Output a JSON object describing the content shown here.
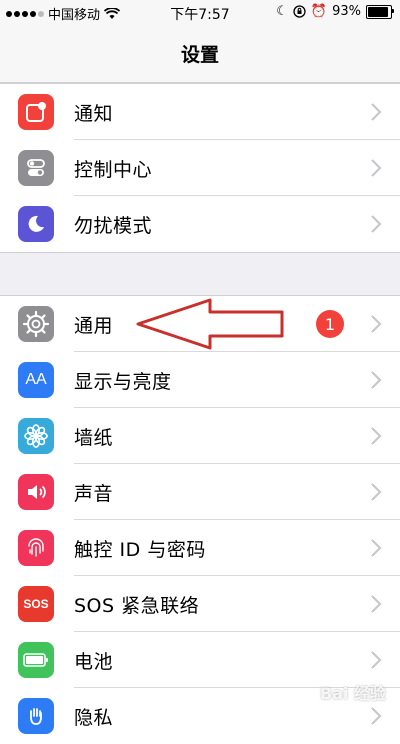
{
  "status_bar": {
    "carrier": "中国移动",
    "time": "下午7:57",
    "battery": "93%"
  },
  "nav": {
    "title": "设置"
  },
  "group1": [
    {
      "label": "通知",
      "icon": "notifications-icon",
      "color": "#f2413b"
    },
    {
      "label": "控制中心",
      "icon": "control-center-icon",
      "color": "#8e8e93"
    },
    {
      "label": "勿扰模式",
      "icon": "moon-icon",
      "color": "#5b55d6"
    }
  ],
  "group2": [
    {
      "label": "通用",
      "icon": "gear-icon",
      "color": "#8e8e93",
      "badge": "1"
    },
    {
      "label": "显示与亮度",
      "icon": "text-size-icon",
      "color": "#2d7cf6",
      "icon_text": "AA"
    },
    {
      "label": "墙纸",
      "icon": "flower-icon",
      "color": "#37aadc"
    },
    {
      "label": "声音",
      "icon": "speaker-icon",
      "color": "#f0345a"
    },
    {
      "label": "触控 ID 与密码",
      "icon": "fingerprint-icon",
      "color": "#f0345a"
    },
    {
      "label": "SOS 紧急联络",
      "icon": "sos-icon",
      "color": "#e8392f",
      "icon_text": "SOS"
    },
    {
      "label": "电池",
      "icon": "battery-icon",
      "color": "#3fc35a"
    },
    {
      "label": "隐私",
      "icon": "hand-icon",
      "color": "#2d7cf6"
    }
  ],
  "annotation": {
    "arrow": "red-outline-arrow",
    "color": "#c9302c"
  },
  "watermark": "Bai 经验"
}
